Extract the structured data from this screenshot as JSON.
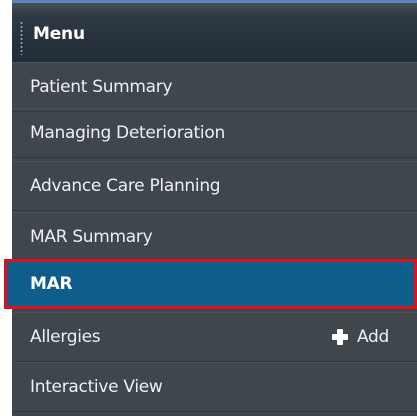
{
  "menu": {
    "title": "Menu",
    "items": [
      {
        "label": "Patient Summary"
      },
      {
        "label": "Managing Deterioration"
      },
      {
        "label": "Advance Care Planning"
      },
      {
        "label": "MAR Summary"
      },
      {
        "label": "MAR",
        "selected": true
      },
      {
        "label": "Allergies",
        "action_label": "Add",
        "action_icon": "plus-icon"
      },
      {
        "label": "Interactive View"
      }
    ]
  },
  "colors": {
    "panel_bg": "#3f464c",
    "selected_bg": "#0f5d8b",
    "highlight_border": "#e0101a",
    "header_accent": "#5b86b8"
  }
}
